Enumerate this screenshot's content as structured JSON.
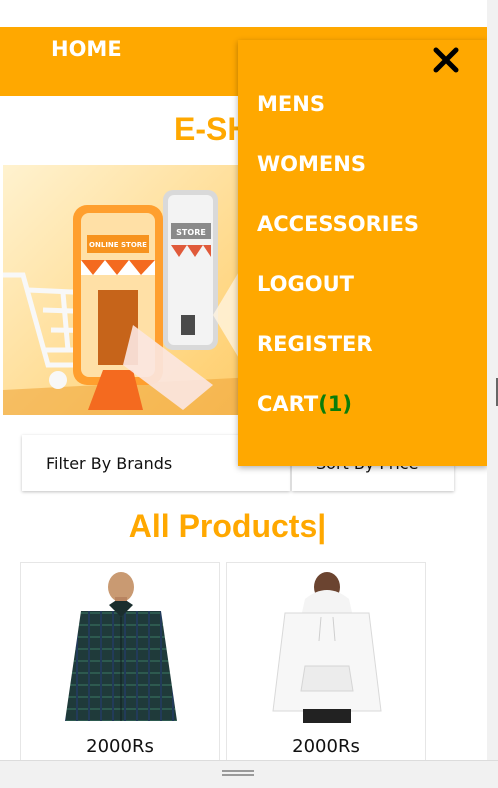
{
  "navbar": {
    "home_label": "HOME",
    "color": "#ffa800"
  },
  "site": {
    "title_visible": "E-SH"
  },
  "banner": {
    "store_sign_1": "ONLINE STORE",
    "store_sign_2": "STORE"
  },
  "filters": {
    "brand_label": "Filter By Brands",
    "sort_label": "Sort By Price"
  },
  "products": {
    "heading": "All Products|",
    "items": [
      {
        "price": "2000Rs",
        "image": "plaid-shirt"
      },
      {
        "price": "2000Rs",
        "image": "white-hoodie"
      }
    ]
  },
  "menu": {
    "close_icon": "close-icon",
    "items": [
      {
        "label": "MENS"
      },
      {
        "label": "WOMENS"
      },
      {
        "label": "ACCESSORIES"
      },
      {
        "label": "LOGOUT"
      },
      {
        "label": "REGISTER"
      },
      {
        "label": "CART",
        "count": "(1)"
      }
    ]
  },
  "colors": {
    "accent": "#ffa800",
    "cart_count": "#0a7d0a"
  }
}
